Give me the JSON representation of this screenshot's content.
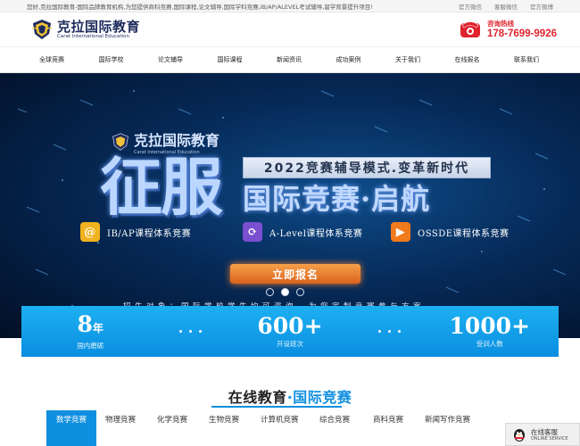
{
  "topbar": {
    "intro": "您好,克拉国际教育-国际品牌教育机构,为您提供商科竞赛,国际课程,论文辅导,国际学科竞赛,IB/AP/ALEVEL考试辅导,留学背景提升项目!",
    "links": [
      "官方微信",
      "客服微信",
      "官方微博"
    ]
  },
  "header": {
    "logo_cn": "克拉国际教育",
    "logo_en": "Carat International Education",
    "hotline_label": "咨询热线",
    "hotline_number": "178-7699-9926"
  },
  "nav": [
    "全球竞赛",
    "国际学校",
    "论文辅导",
    "国际课程",
    "新闻资讯",
    "成功案例",
    "关于我们",
    "在线报名",
    "联系我们"
  ],
  "hero": {
    "logo_cn": "克拉国际教育",
    "logo_en": "Carat International Education",
    "big": "征服",
    "slogan": "2022竞赛辅导模式.变革新时代",
    "sub": "国际竞赛·启航",
    "systems": [
      "IB/AP课程体系竞赛",
      "A-Level课程体系竞赛",
      "OSSDE课程体系竞赛"
    ],
    "cta": "立即报名",
    "target": "招生对象：国际学校学生均可咨询，为您定制竞赛参与方案"
  },
  "stats": [
    {
      "value": "8",
      "unit": "年",
      "label": "国内磨砺"
    },
    {
      "value": "600+",
      "unit": "",
      "label": "开设班次"
    },
    {
      "value": "1000+",
      "unit": "",
      "label": "受训人数"
    }
  ],
  "section": {
    "title_a": "在线教育",
    "title_dot": "·",
    "title_b": "国际竞赛"
  },
  "tabs": [
    "数学竞赛",
    "物理竞赛",
    "化学竞赛",
    "生物竞赛",
    "计算机竞赛",
    "综合竞赛",
    "商科竞赛",
    "新闻写作竞赛"
  ],
  "service": {
    "cn": "在线客服",
    "en": "ONLINE SERVICE"
  },
  "colors": {
    "accent": "#0f8fdf",
    "hotline": "#e0232e",
    "cta": "#e8782e",
    "hero_bg": "#062a58"
  }
}
